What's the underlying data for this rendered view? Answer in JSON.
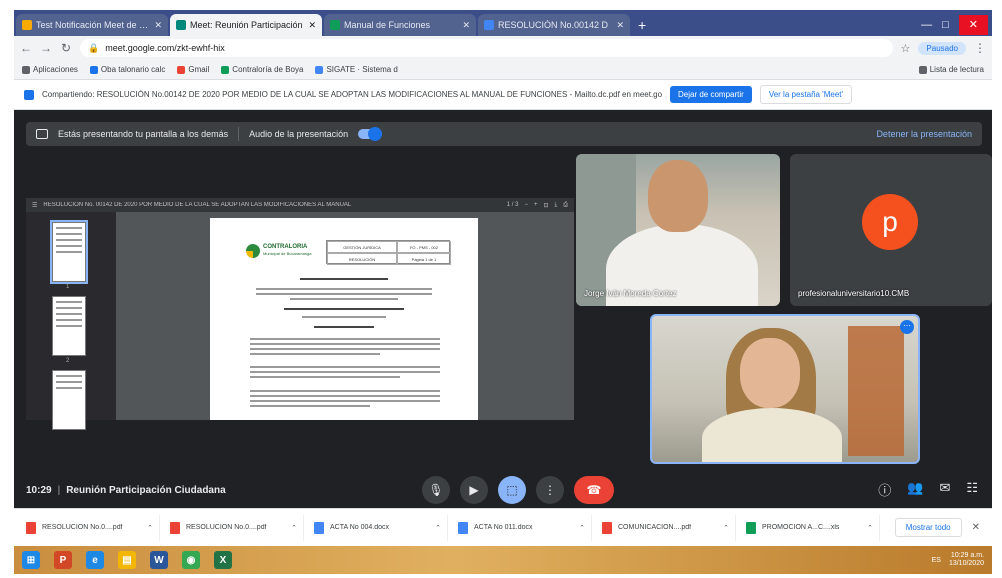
{
  "browser": {
    "tabs": [
      {
        "label": "Test Notificación Meet de serv",
        "color": "#f9ab00"
      },
      {
        "label": "Meet: Reunión Participación",
        "color": "#00897b",
        "active": true
      },
      {
        "label": "Manual de Funciones",
        "color": "#0f9d58"
      },
      {
        "label": "RESOLUCIÓN No.00142 D",
        "color": "#4285f4"
      }
    ],
    "new_tab": "+",
    "window_controls": {
      "minimize": "—",
      "maximize": "□",
      "close": "✕"
    },
    "address": "meet.google.com/zkt-ewhf-hix",
    "profile_label": "Pausado",
    "bookmarks": [
      {
        "label": "Aplicaciones",
        "color": "#5f6368"
      },
      {
        "label": "Oba talonario calc",
        "color": "#1a73e8"
      },
      {
        "label": "Gmail",
        "color": "#ea4335"
      },
      {
        "label": "Contraloría de Boya",
        "color": "#0f9d58"
      },
      {
        "label": "SIGATE · Sistema d",
        "color": "#4285f4"
      }
    ],
    "reading_list": "Lista de lectura"
  },
  "share_banner": {
    "text": "Compartiendo: RESOLUCIÓN No.00142 DE 2020 POR MEDIO DE LA CUAL SE ADOPTAN LAS MODIFICACIONES AL MANUAL DE FUNCIONES - Mailto.dc.pdf en meet.google.com",
    "primary_button": "Dejar de compartir",
    "secondary_button": "Ver la pestaña 'Meet'"
  },
  "meet": {
    "present_bar_text": "Estás presentando tu pantalla a los demás",
    "audio_label": "Audio de la presentación",
    "stop_presenting": "Detener la presentación",
    "doc_title": "RESOLUCIÓN No. 00142 DE 2020 POR MEDIO DE LA CUAL SE ADOPTAN LAS MODIFICACIONES AL MANUAL",
    "doc_page_indicator": "1 / 3",
    "doc_org": "CONTRALORIA",
    "doc_org_sub": "Municipal de Bucaramanga",
    "doc_header_cells": [
      "GESTIÓN JURÍDICA",
      "FO - PMS - 002",
      "RESOLUCIÓN",
      "Página 1 de 1"
    ],
    "participants": [
      {
        "name": "Jorge Iván Moreda Cortez"
      },
      {
        "name": "profesionaluniversitario10.CMB",
        "initial": "p"
      },
      {
        "name": ""
      }
    ],
    "time": "10:29",
    "separator": "|",
    "meeting_title": "Reunión Participación Ciudadana"
  },
  "downloads": {
    "items": [
      {
        "name": "RESOLUCION No.0....pdf",
        "color": "#ea4335"
      },
      {
        "name": "RESOLUCIÓN No.0....pdf",
        "color": "#ea4335"
      },
      {
        "name": "ACTA No 004.docx",
        "color": "#4285f4"
      },
      {
        "name": "ACTA No 011.docx",
        "color": "#4285f4"
      },
      {
        "name": "COMUNICACION....pdf",
        "color": "#ea4335"
      },
      {
        "name": "PROMOCIÓN A...C....xls",
        "color": "#0f9d58"
      }
    ],
    "show_all": "Mostrar todo",
    "close": "✕"
  },
  "taskbar": {
    "apps": [
      {
        "label": "⊞",
        "color": "#1e88e5"
      },
      {
        "label": "P",
        "color": "#d24726"
      },
      {
        "label": "e",
        "color": "#1e88e5"
      },
      {
        "label": "▤",
        "color": "#f2b705"
      },
      {
        "label": "W",
        "color": "#2b579a"
      },
      {
        "label": "◉",
        "color": "#34a853"
      },
      {
        "label": "X",
        "color": "#217346"
      }
    ],
    "tray_text": "ES",
    "time": "10:29 a.m.",
    "date": "13/10/2020"
  }
}
